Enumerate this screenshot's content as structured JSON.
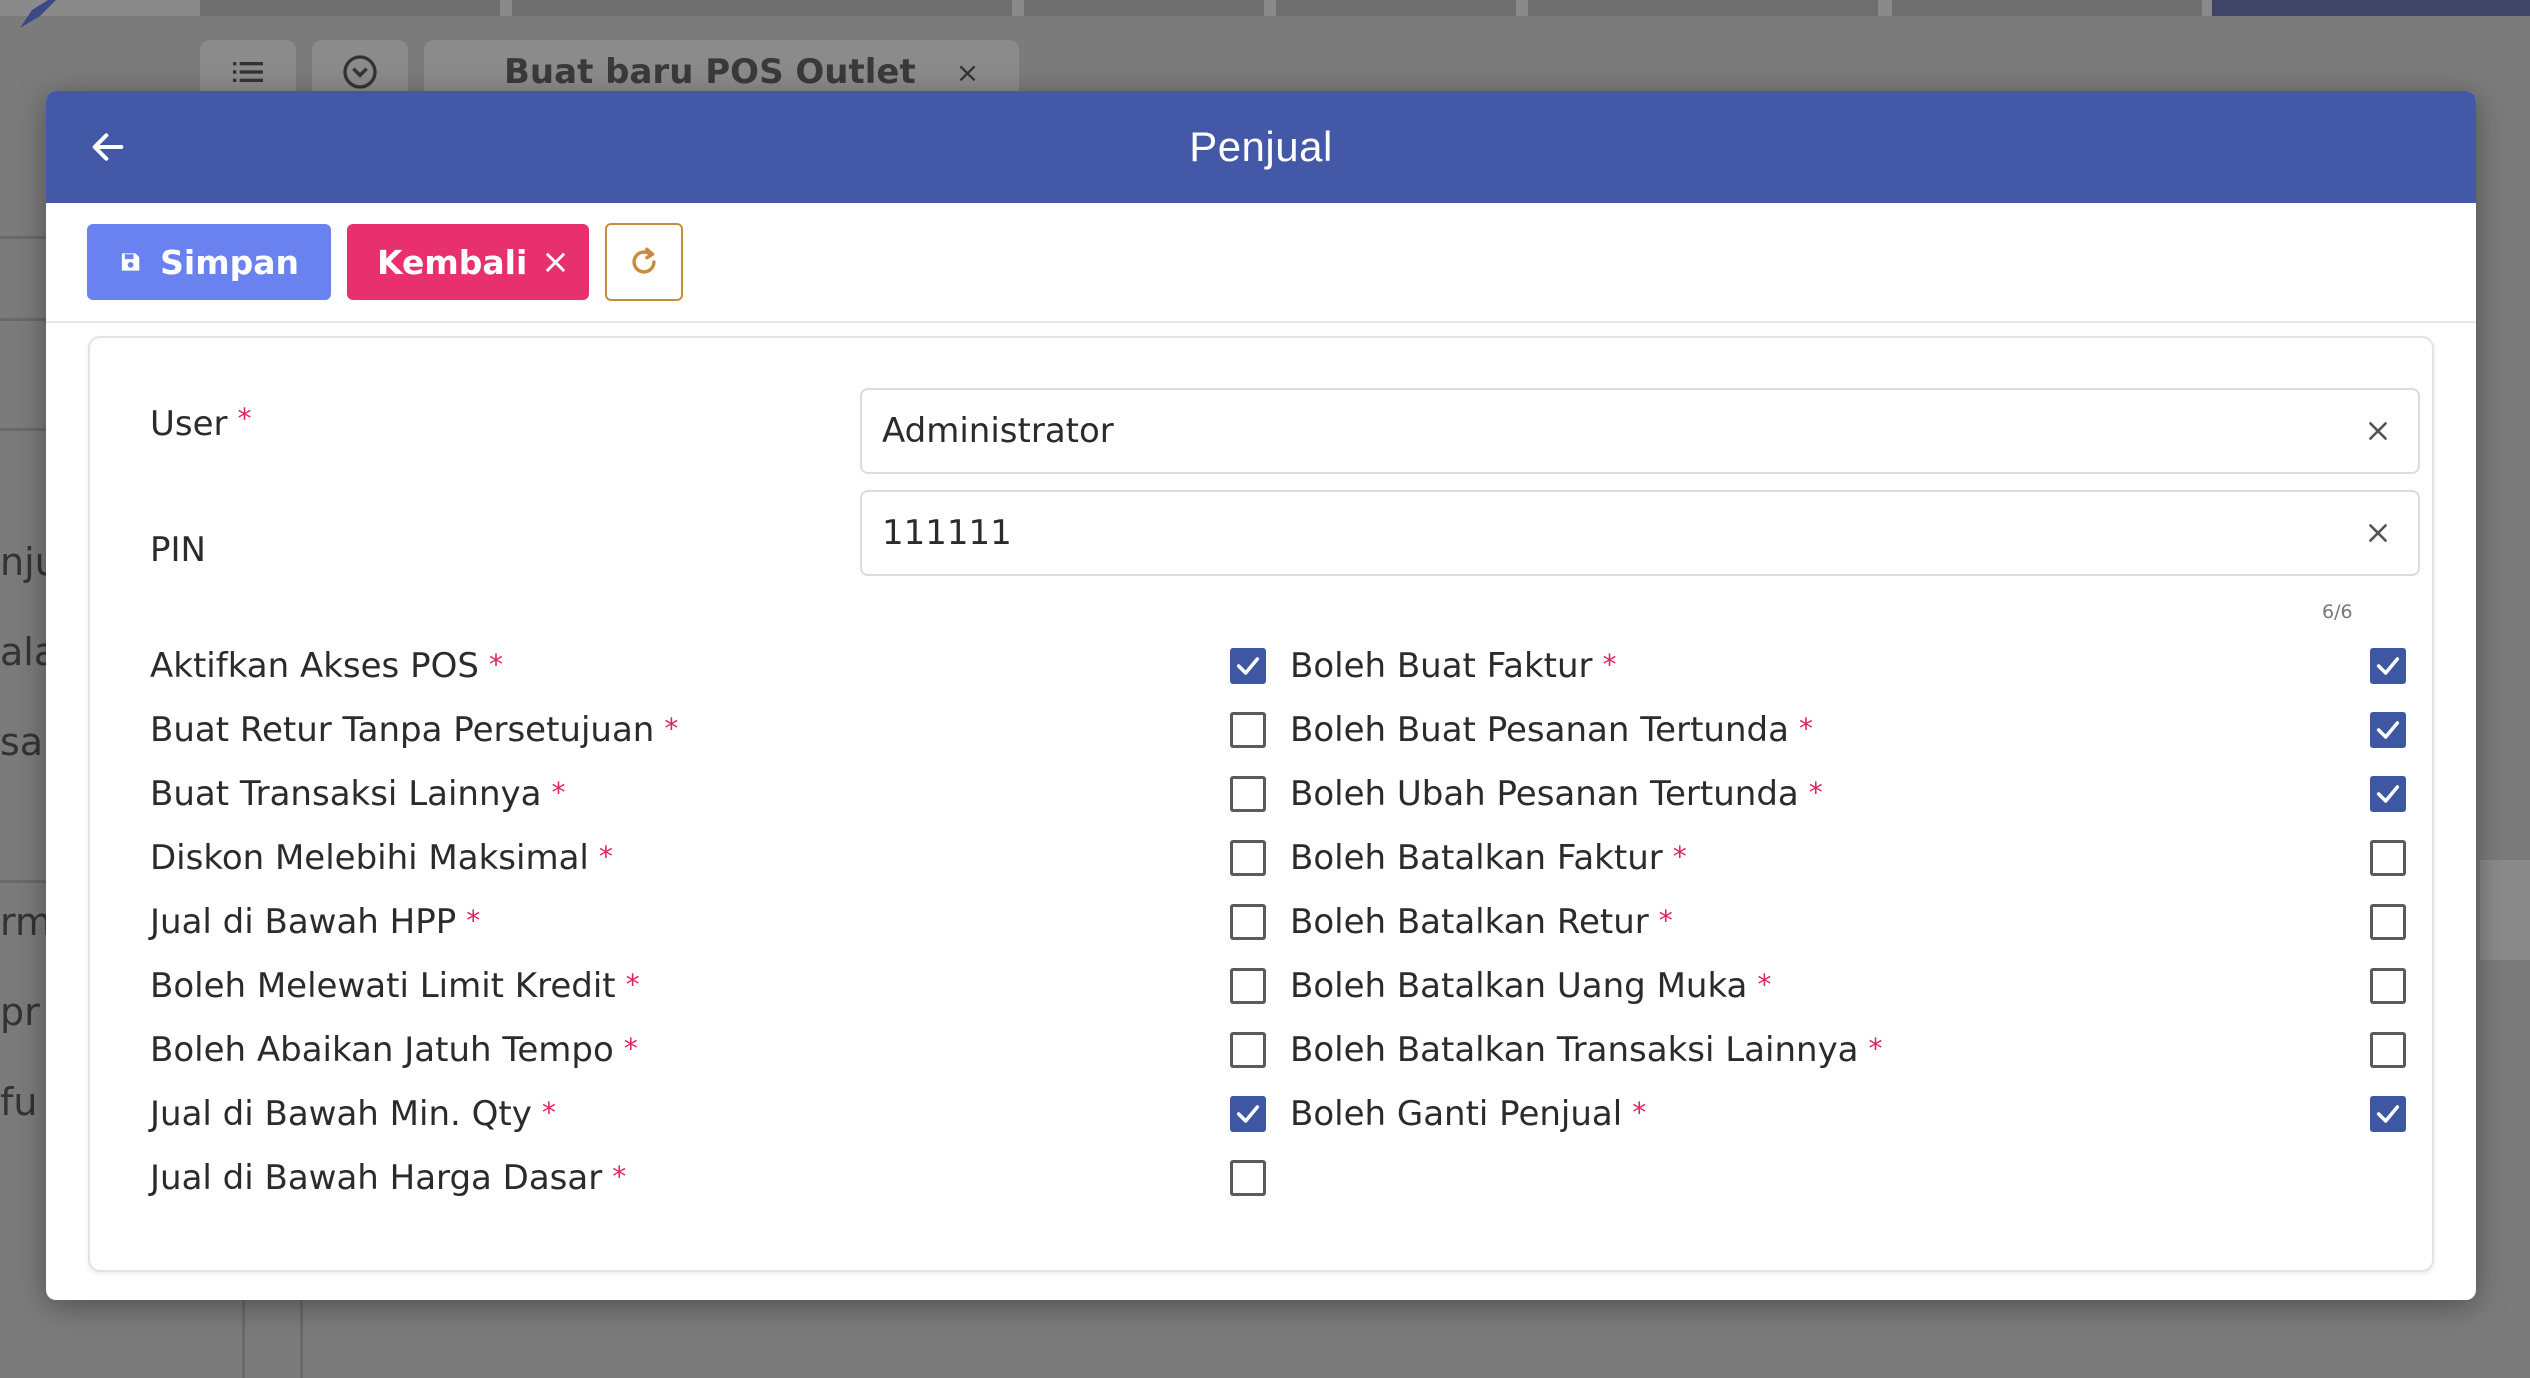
{
  "background": {
    "tab_label": "Buat baru POS Outlet",
    "tab_close": "×",
    "side_fragments": [
      "nju",
      "ala",
      "sa",
      "rm",
      "pr",
      "fu"
    ]
  },
  "modal": {
    "title": "Penjual",
    "toolbar": {
      "save_label": "Simpan",
      "back_label": "Kembali",
      "back_icon": "×"
    },
    "fields": {
      "user": {
        "label": "User",
        "required": "*",
        "value": "Administrator"
      },
      "pin": {
        "label": "PIN",
        "value": "111111",
        "counter": "6/6"
      }
    },
    "checkboxes_left": [
      {
        "label": "Aktifkan Akses POS",
        "req": "*",
        "checked": true
      },
      {
        "label": "Buat Retur Tanpa Persetujuan",
        "req": "*",
        "checked": false
      },
      {
        "label": "Buat Transaksi Lainnya",
        "req": "*",
        "checked": false
      },
      {
        "label": "Diskon Melebihi Maksimal",
        "req": "*",
        "checked": false
      },
      {
        "label": "Jual di Bawah HPP",
        "req": "*",
        "checked": false
      },
      {
        "label": "Boleh Melewati Limit Kredit",
        "req": "*",
        "checked": false
      },
      {
        "label": "Boleh Abaikan Jatuh Tempo",
        "req": "*",
        "checked": false
      },
      {
        "label": "Jual di Bawah Min. Qty",
        "req": "*",
        "checked": true
      },
      {
        "label": "Jual di Bawah Harga Dasar",
        "req": "*",
        "checked": false
      }
    ],
    "checkboxes_right": [
      {
        "label": "Boleh Buat Faktur",
        "req": "*",
        "checked": true
      },
      {
        "label": "Boleh Buat Pesanan Tertunda",
        "req": "*",
        "checked": true
      },
      {
        "label": "Boleh Ubah Pesanan Tertunda",
        "req": "*",
        "checked": true
      },
      {
        "label": "Boleh Batalkan Faktur",
        "req": "*",
        "checked": false
      },
      {
        "label": "Boleh Batalkan Retur",
        "req": "*",
        "checked": false
      },
      {
        "label": "Boleh Batalkan Uang Muka",
        "req": "*",
        "checked": false
      },
      {
        "label": "Boleh Batalkan Transaksi Lainnya",
        "req": "*",
        "checked": false
      },
      {
        "label": "Boleh Ganti Penjual",
        "req": "*",
        "checked": true
      }
    ]
  },
  "colors": {
    "header": "#4359a7",
    "save": "#6a82ef",
    "back": "#e8306f",
    "refresh_border": "#c98b3c",
    "checked": "#3f57a3",
    "required": "#e0245e"
  }
}
